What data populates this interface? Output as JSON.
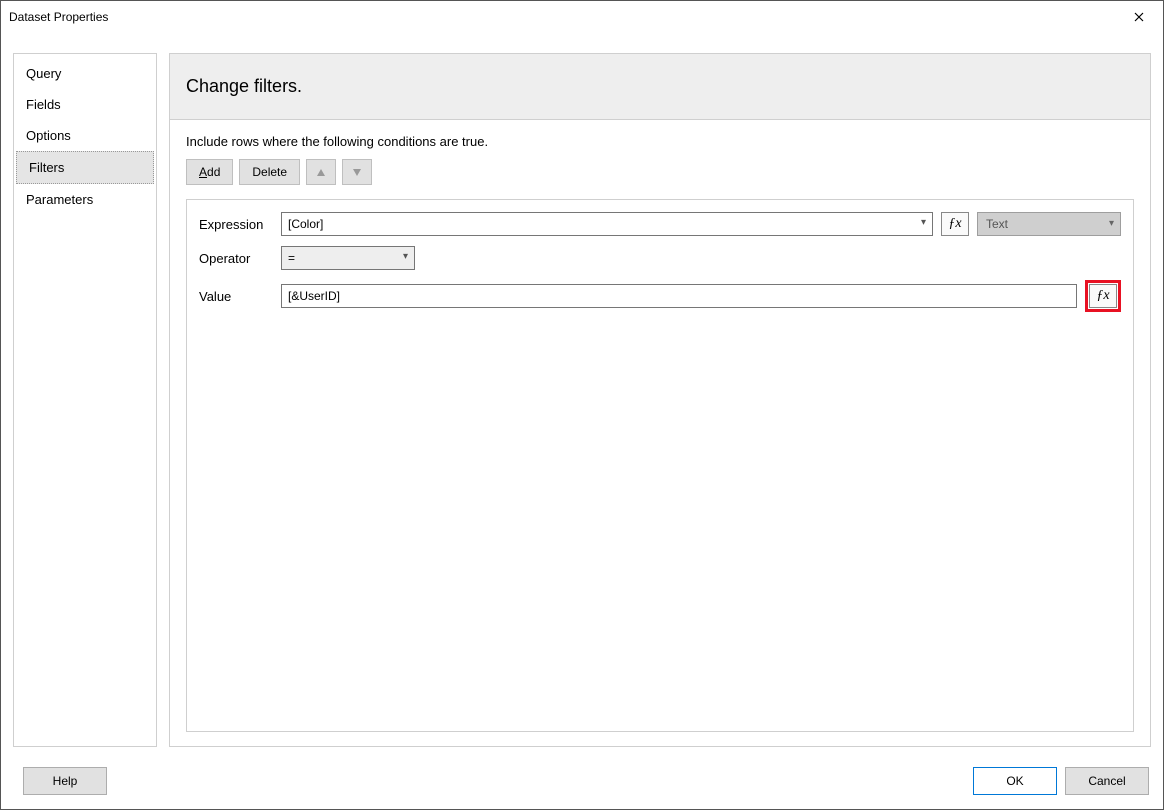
{
  "window": {
    "title": "Dataset Properties"
  },
  "sidebar": {
    "items": [
      {
        "label": "Query"
      },
      {
        "label": "Fields"
      },
      {
        "label": "Options"
      },
      {
        "label": "Filters",
        "selected": true
      },
      {
        "label": "Parameters"
      }
    ]
  },
  "header": {
    "title": "Change filters."
  },
  "instruction": "Include rows where the following conditions are true.",
  "toolbar": {
    "add_label": "Add",
    "delete_label": "Delete"
  },
  "filter": {
    "expression_label": "Expression",
    "expression_value": "[Color]",
    "type_value": "Text",
    "operator_label": "Operator",
    "operator_value": "=",
    "value_label": "Value",
    "value_value": "[&UserID]"
  },
  "footer": {
    "help_label": "Help",
    "ok_label": "OK",
    "cancel_label": "Cancel"
  }
}
